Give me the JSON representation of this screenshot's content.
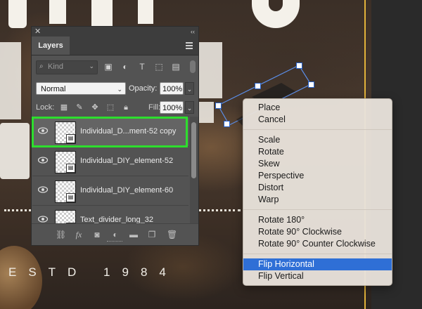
{
  "layers_panel": {
    "tab_label": "Layers",
    "filter_kind": "Kind",
    "blend_mode": "Normal",
    "opacity_label": "Opacity:",
    "opacity_value": "100%",
    "lock_label": "Lock:",
    "fill_label": "Fill:",
    "fill_value": "100%",
    "layers": [
      {
        "name": "Individual_D...ment-52 copy",
        "selected": true
      },
      {
        "name": "Individual_DIY_element-52",
        "selected": false
      },
      {
        "name": "Individual_DIY_element-60",
        "selected": false
      },
      {
        "name": "Text_divider_long_32",
        "selected": false
      }
    ]
  },
  "context_menu": {
    "groups": [
      [
        "Place",
        "Cancel"
      ],
      [
        "Scale",
        "Rotate",
        "Skew",
        "Perspective",
        "Distort",
        "Warp"
      ],
      [
        "Rotate 180°",
        "Rotate 90° Clockwise",
        "Rotate 90° Counter Clockwise"
      ],
      [
        "Flip Horizontal",
        "Flip Vertical"
      ]
    ],
    "highlighted": "Flip Horizontal"
  },
  "canvas": {
    "estd_text": "ESTD 1984"
  },
  "colors": {
    "highlight": "#2f6fd6",
    "selection_outline": "#2dde2d",
    "accent_line": "#e2b23a"
  }
}
